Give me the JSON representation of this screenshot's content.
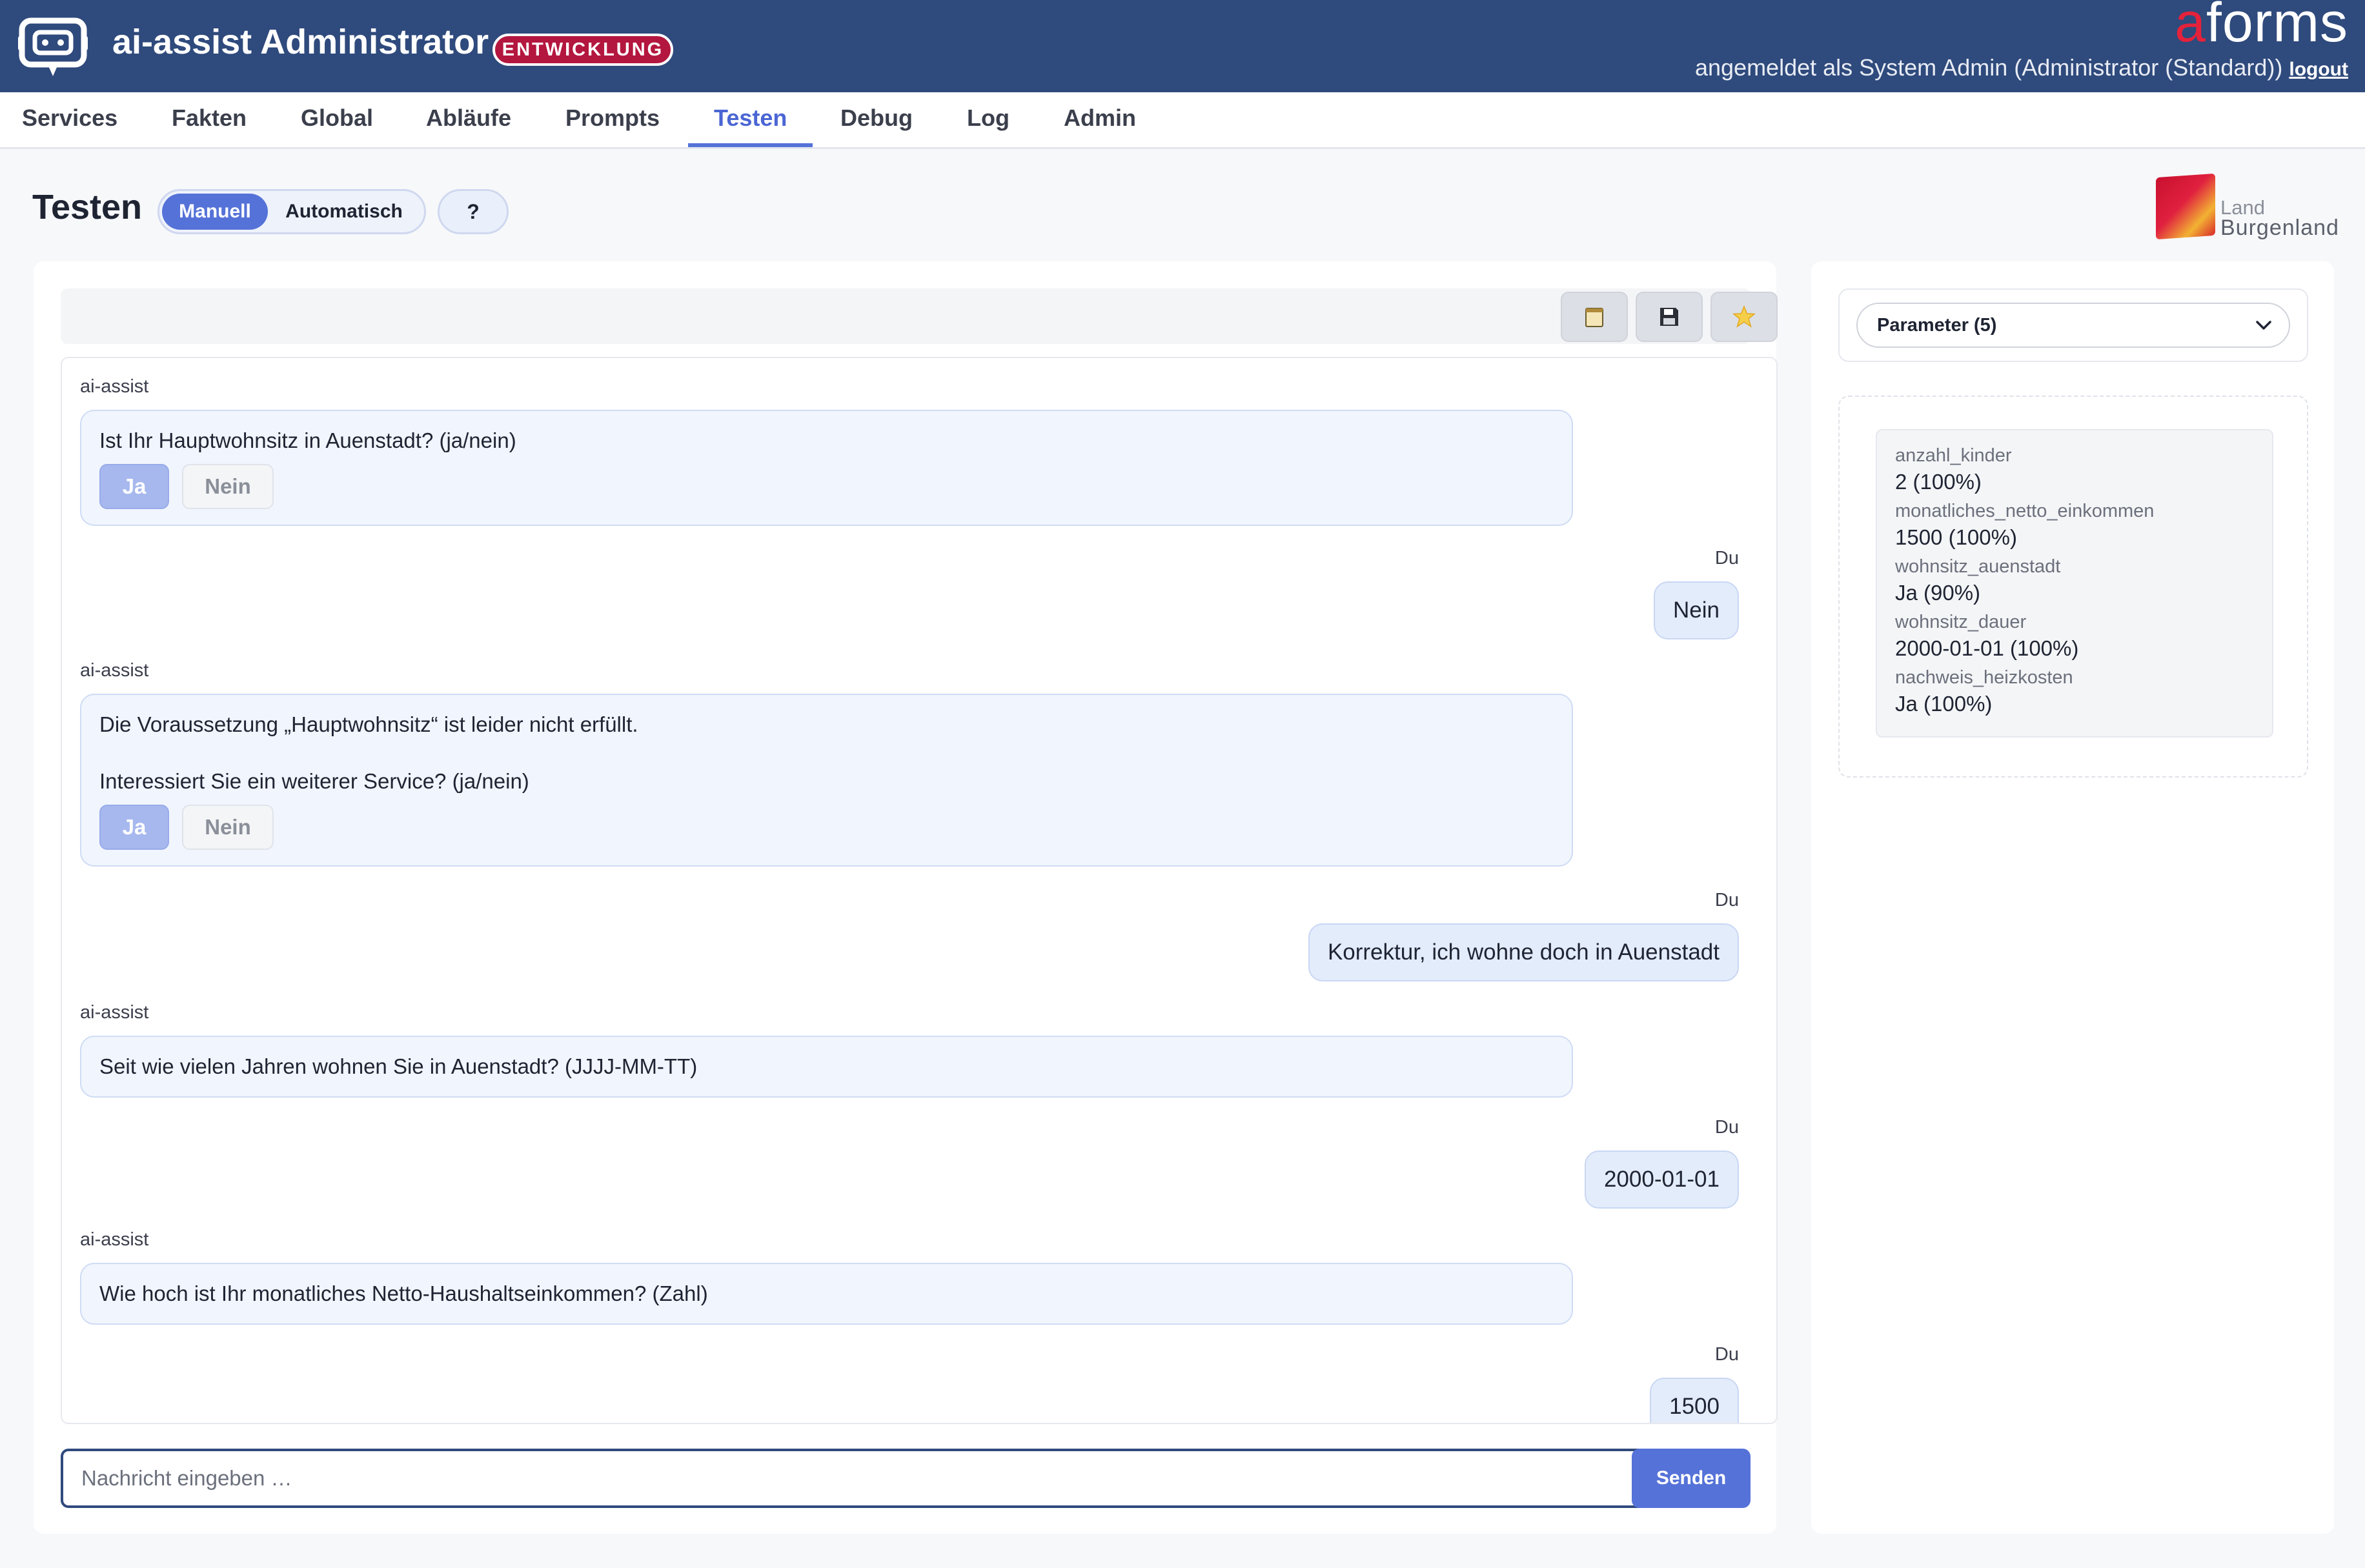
{
  "header": {
    "app_title": "ai-assist Administrator",
    "env_badge": "ENTWICKLUNG",
    "brand_a": "a",
    "brand_rest": "forms",
    "login_text": "angemeldet als System Admin (Administrator (Standard))",
    "logout_label": "logout"
  },
  "nav": {
    "tabs": [
      "Services",
      "Fakten",
      "Global",
      "Abläufe",
      "Prompts",
      "Testen",
      "Debug",
      "Log",
      "Admin"
    ],
    "active": "Testen"
  },
  "page": {
    "title": "Testen",
    "mode_manual": "Manuell",
    "mode_auto": "Automatisch",
    "help_label": "?",
    "logo_line1": "Land",
    "logo_line2": "Burgenland"
  },
  "toolbar": {
    "icons": [
      "notepad-icon",
      "save-icon",
      "star-icon"
    ]
  },
  "chat": {
    "bot_name": "ai-assist",
    "user_name": "Du",
    "messages": [
      {
        "from": "ai-assist",
        "text": "Ist Ihr Hauptwohnsitz in Auenstadt? (ja/nein)",
        "yes": "Ja",
        "no": "Nein"
      },
      {
        "from": "Du",
        "text": "Nein"
      },
      {
        "from": "ai-assist",
        "text": "Die Voraussetzung „Hauptwohnsitz“ ist leider nicht erfüllt.",
        "text2": "Interessiert Sie ein weiterer Service? (ja/nein)",
        "yes": "Ja",
        "no": "Nein"
      },
      {
        "from": "Du",
        "text": "Korrektur, ich wohne doch in Auenstadt"
      },
      {
        "from": "ai-assist",
        "text": "Seit wie vielen Jahren wohnen Sie in Auenstadt? (JJJJ-MM-TT)"
      },
      {
        "from": "Du",
        "text": "2000-01-01"
      },
      {
        "from": "ai-assist",
        "text": "Wie hoch ist Ihr monatliches Netto-Haushaltseinkommen? (Zahl)"
      },
      {
        "from": "Du",
        "text": "1500"
      }
    ],
    "input_placeholder": "Nachricht eingeben …",
    "input_value": "",
    "send_label": "Senden"
  },
  "parameters": {
    "selector_label": "Parameter (5)",
    "items": [
      {
        "name": "anzahl_kinder",
        "value": "2 (100%)"
      },
      {
        "name": "monatliches_netto_einkommen",
        "value": "1500 (100%)"
      },
      {
        "name": "wohnsitz_auenstadt",
        "value": "Ja (90%)"
      },
      {
        "name": "wohnsitz_dauer",
        "value": "2000-01-01 (100%)"
      },
      {
        "name": "nachweis_heizkosten",
        "value": "Ja (100%)"
      }
    ]
  },
  "colors": {
    "header_bg": "#2f4a7c",
    "accent": "#5572d8",
    "badge": "#b3163e",
    "brand_a": "#e5223b"
  }
}
